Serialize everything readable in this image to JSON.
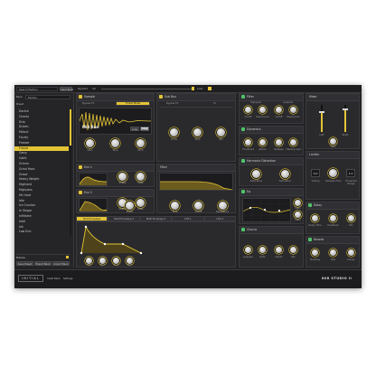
{
  "colors": {
    "accent": "#e3c435",
    "bg": "#232325",
    "panel": "#2a2a2d",
    "active_green": "#4fc36a"
  },
  "top_bar": {
    "search_placeholder": "Search Factory",
    "clear_label": "Clear Bank",
    "keyword_label": "Keyword",
    "volume_label": "Vol",
    "load_label": "Load"
  },
  "browser": {
    "bank_label": "Bank",
    "bank_value": "Factory",
    "column_header": "Preset",
    "items": [
      "Dorkut",
      "Chants",
      "Drip",
      "Driven",
      "Fallout",
      "Fourty",
      "Freezer",
      "Future",
      "Gang",
      "Gallit",
      "Grimm",
      "Grind Hard",
      "Grove",
      "Heavy Weight",
      "Highland",
      "Highpass",
      "Hit Hard",
      "Idle",
      "Ice Crusher",
      "In Shape",
      "Infiltrate",
      "Intel",
      "Ink",
      "Low End"
    ],
    "selected_index": 7,
    "current_preset": "Future",
    "buttons": [
      "Save Preset",
      "Export Bank",
      "Import Bank"
    ]
  },
  "sampler": {
    "title": "Sample",
    "bypass_label": "Bypass FX",
    "mode_label": "Follow Mode",
    "sample_name": "Mid Run",
    "loop_btn": "Loop",
    "select_btn": "Select",
    "knob_labels": [
      "Gain",
      "Tune",
      "Pitch"
    ]
  },
  "env1": {
    "title": "Env 1",
    "knob_labels": [
      "Shape",
      "Rate"
    ]
  },
  "env2": {
    "title": "Env 2",
    "knob_labels": [
      "Shape",
      "Rate"
    ]
  },
  "fx": {
    "title": "Sub Bus",
    "bypass_label": "Bypass FX",
    "fx_label": "Fx",
    "knob_labels": [
      "Drive",
      "Tone",
      "Mix"
    ]
  },
  "filter": {
    "title": "Filter",
    "knob_labels": [
      "Drive",
      "Tone",
      "Cutoff",
      "Resonance"
    ]
  },
  "tabs": [
    "Multi Envelope",
    "Multi Envelope 2",
    "Multi Envelope 3",
    "LFO 1",
    "LFO 2"
  ],
  "mseg": {
    "knob_labels": [
      "Atk",
      "Dec",
      "Sus",
      "Rel"
    ]
  },
  "right": {
    "filter": {
      "title": "Filter",
      "section_labels": [
        "Highpass",
        "Lowpass"
      ],
      "knob_labels": [
        "Cutoff",
        "Resonance",
        "Cutoff",
        "Resonance"
      ]
    },
    "dynamics": {
      "title": "Dynamics",
      "knob_labels": [
        "Threshold",
        "Attack",
        "Release",
        "Makeup Gain"
      ]
    },
    "harmonic": {
      "title": "Harmonic Distortion",
      "knob_labels": [
        "Saturation",
        "Saturation"
      ]
    },
    "eq": {
      "title": "Eq",
      "knob_labels": [
        "Gain",
        "Gain"
      ]
    },
    "chorus": {
      "title": "Chorus",
      "knob_labels": [
        "Lowpass",
        "Rate",
        "Depth",
        "Mix"
      ]
    },
    "stereo_spread": {
      "title": "Stereo Spread"
    },
    "mixer": {
      "title": "Mixer",
      "labels": [
        "Left",
        "Right",
        "Gain"
      ],
      "levels": [
        0.75,
        0.82
      ]
    },
    "limiter": {
      "title": "Limiter",
      "box_values": [
        "0.0",
        "1.0"
      ],
      "labels": [
        "Ceiling",
        "Release Time",
        "Threshold Range"
      ]
    },
    "delay": {
      "title": "Delay",
      "knob_labels": [
        "Delay Time",
        "Feedback",
        "Mix"
      ]
    },
    "reverb": {
      "title": "Reverb",
      "knob_labels": [
        "Predelay",
        "Size",
        "Decay"
      ]
    }
  },
  "footer": {
    "logo": "INITIAL",
    "links": [
      "Instal Bank",
      "Settings"
    ],
    "brand": "808 STUDIO II"
  }
}
